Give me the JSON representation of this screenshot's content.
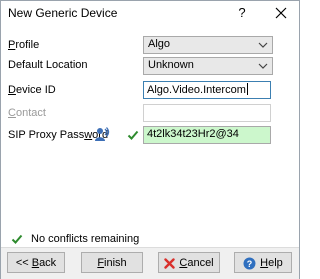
{
  "window": {
    "title": "New Generic Device",
    "help_glyph": "?",
    "close_glyph": "✕"
  },
  "form": {
    "profile": {
      "label_access": "P",
      "label_rest": "rofile",
      "value": "Algo"
    },
    "default_location": {
      "label": "Default Location",
      "value": "Unknown"
    },
    "device_id": {
      "label_access": "D",
      "label_rest": "evice ID",
      "value": "Algo.Video.Intercom"
    },
    "contact": {
      "label_pre": "",
      "label_access": "C",
      "label_rest": "ontact",
      "value": ""
    },
    "sip_proxy_password": {
      "label_pre": "SIP Proxy Pass",
      "label_access": "w",
      "label_rest": "ord",
      "value": "4t2lk34t23Hr2@34"
    }
  },
  "status": {
    "text": "No conflicts remaining"
  },
  "buttons": {
    "back": {
      "prefix": "<< ",
      "access": "B",
      "rest": "ack"
    },
    "finish": {
      "access": "F",
      "rest": "inish"
    },
    "cancel": {
      "access": "C",
      "rest": "ancel"
    },
    "help": {
      "access": "H",
      "rest": "elp"
    }
  },
  "colors": {
    "valid_field": "#ccf7cc",
    "check_green": "#2e8b2e",
    "cancel_red": "#d9302c",
    "help_blue": "#2f6fbf",
    "active_border": "#3c7fb1"
  }
}
